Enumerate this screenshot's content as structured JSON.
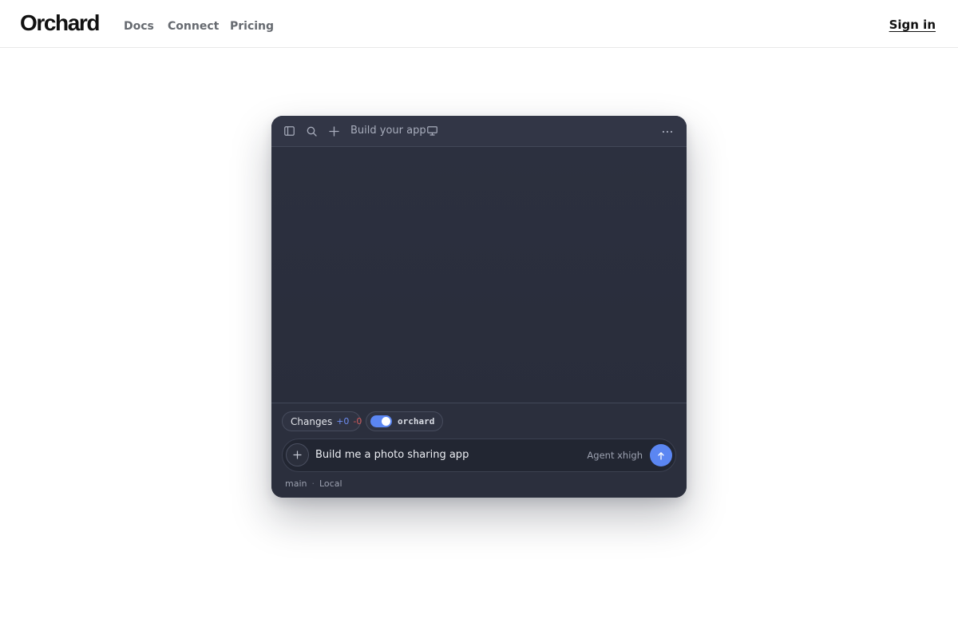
{
  "nav": {
    "logo": "Orchard",
    "links": [
      "Docs",
      "Connect",
      "Pricing"
    ],
    "sign_in": "Sign in"
  },
  "app": {
    "title": "Build your app",
    "icons": {
      "sidebar": "sidebar-toggle-icon",
      "search": "search-icon",
      "new": "plus-icon",
      "preview": "monitor-icon",
      "more": "more-horizontal-icon"
    },
    "changes": {
      "label": "Changes",
      "added": "+0",
      "removed": "-0"
    },
    "repo": {
      "name": "orchard",
      "enabled": true
    },
    "input": {
      "value": "Build me a photo sharing app",
      "agent": "Agent xhigh"
    },
    "footer": {
      "branch": "main",
      "separator": "·",
      "location": "Local"
    }
  },
  "colors": {
    "accent": "#5b86f2",
    "panel": "#2b2f3d",
    "added": "#6f8ff5",
    "removed": "#d25a5a"
  }
}
